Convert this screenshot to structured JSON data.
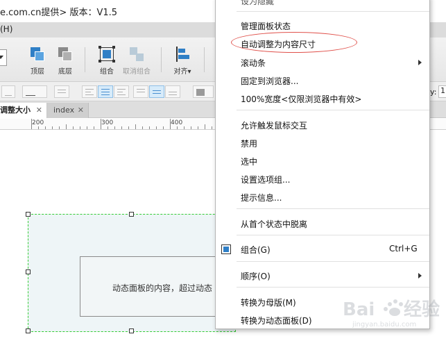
{
  "window": {
    "title": "e.com.cn提供> 版本：V1.5"
  },
  "menubar": {
    "item_help": "(H)"
  },
  "toolbar": {
    "top": "顶层",
    "bottom": "底层",
    "group": "组合",
    "ungroup": "取消组合",
    "align": "对齐▾"
  },
  "formatbar": {
    "y_label": "y:",
    "y_value": "1"
  },
  "tabs": [
    {
      "label": "调整大小",
      "close": "✕"
    },
    {
      "label": "index",
      "close": "✕"
    }
  ],
  "ruler": {
    "marks": [
      "200",
      "300",
      "400"
    ]
  },
  "canvas": {
    "inner_text": "动态面板的内容，超过动态"
  },
  "context_menu": {
    "top_partial": "设为隐藏",
    "items": [
      {
        "label": "管理面板状态"
      },
      {
        "label": "自动调整为内容尺寸"
      },
      {
        "label": "滚动条",
        "submenu": true
      },
      {
        "label": "固定到浏览器..."
      },
      {
        "label": "100%宽度<仅限浏览器中有效>"
      },
      {
        "label": "允许触发鼠标交互"
      },
      {
        "label": "禁用"
      },
      {
        "label": "选中"
      },
      {
        "label": "设置选项组..."
      },
      {
        "label": "提示信息..."
      },
      {
        "label": "从首个状态中脱离"
      },
      {
        "label": "组合(G)",
        "shortcut": "Ctrl+G"
      },
      {
        "label": "顺序(O)",
        "submenu": true
      },
      {
        "label": "转换为母版(M)"
      },
      {
        "label": "转换为动态面板(D)"
      }
    ]
  },
  "watermark": {
    "text": "Baidu经验",
    "subtext": "jingyan.baidu.com"
  },
  "colors": {
    "accent_blue": "#2f7fc6",
    "highlight_red": "#e0504a",
    "selection_green": "#33cc33"
  }
}
